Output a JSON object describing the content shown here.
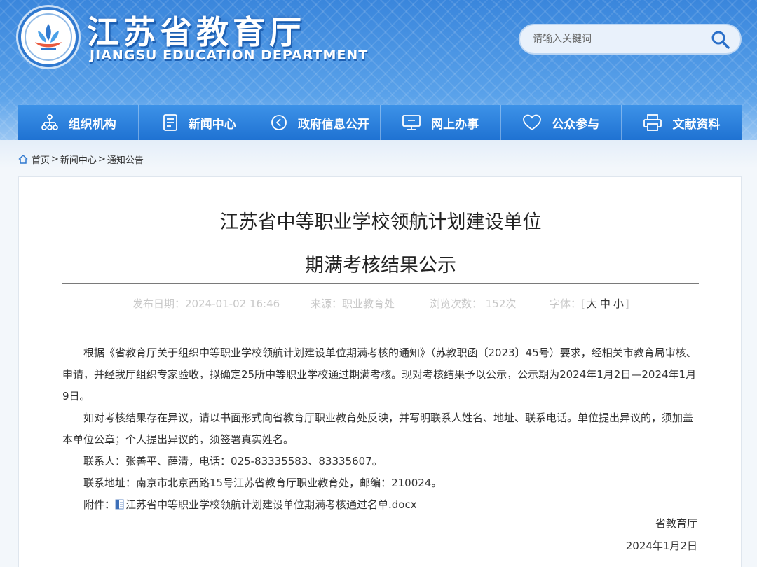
{
  "header": {
    "title": "江苏省教育厅",
    "subtitle": "JIANGSU EDUCATION DEPARTMENT",
    "search_placeholder": "请输入关键词"
  },
  "nav": {
    "items": [
      {
        "label": "组织机构",
        "icon": "org-chart-icon"
      },
      {
        "label": "新闻中心",
        "icon": "document-icon"
      },
      {
        "label": "政府信息公开",
        "icon": "play-circle-icon"
      },
      {
        "label": "网上办事",
        "icon": "monitor-icon"
      },
      {
        "label": "公众参与",
        "icon": "heart-icon"
      },
      {
        "label": "文献资料",
        "icon": "printer-icon"
      }
    ]
  },
  "breadcrumb": {
    "home": "首页",
    "news": "新闻中心",
    "current": "通知公告",
    "separator": ">"
  },
  "article": {
    "title_line1": "江苏省中等职业学校领航计划建设单位",
    "title_line2": "期满考核结果公示",
    "meta": {
      "date": "发布日期：2024-01-02 16:46",
      "source": "来源：职业教育处",
      "views": "浏览次数： 152次",
      "font_label": "字体：",
      "font_open": "[",
      "font_large": "大",
      "font_medium": "中",
      "font_small": "小",
      "font_close": "]"
    },
    "paragraphs": [
      "根据《省教育厅关于组织中等职业学校领航计划建设单位期满考核的通知》（苏教职函〔2023〕45号）要求，经相关市教育局审核、申请，并经我厅组织专家验收，拟确定25所中等职业学校通过期满考核。现对考核结果予以公示，公示期为2024年1月2日—2024年1月9日。",
      "如对考核结果存在异议，请以书面形式向省教育厅职业教育处反映，并写明联系人姓名、地址、联系电话。单位提出异议的，须加盖本单位公章；个人提出异议的，须签署真实姓名。",
      "联系人：张善平、薛清，电话：025-83335583、83335607。",
      "联系地址：南京市北京西路15号江苏省教育厅职业教育处，邮编：210024。"
    ],
    "attachment_label": "附件：",
    "attachment_name": "江苏省中等职业学校领航计划建设单位期满考核通过名单.docx",
    "signature": "省教育厅",
    "sign_date": "2024年1月2日"
  },
  "colors": {
    "header_blue": "#3f8de0",
    "nav_blue": "#1f72d2",
    "meta_gray": "#c8c8c8",
    "text": "#333333"
  }
}
